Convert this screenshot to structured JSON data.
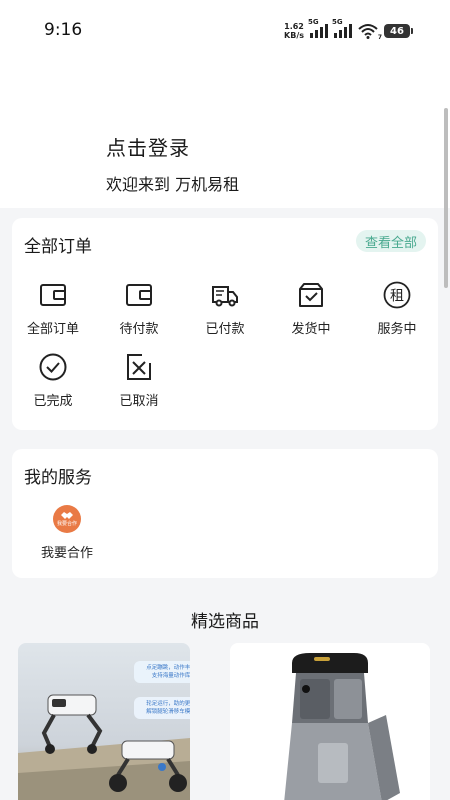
{
  "status_bar": {
    "time": "9:16",
    "net_speed_value": "1.62",
    "net_speed_unit": "KB/s",
    "signal1_tag": "5G",
    "signal2_tag": "5G",
    "wifi_tag": "7",
    "battery": "46"
  },
  "header": {
    "login_text": "点击登录",
    "welcome_text": "欢迎来到 万机易租"
  },
  "orders": {
    "title": "全部订单",
    "view_all": "查看全部",
    "items": [
      {
        "label": "全部订单",
        "icon": "wallet-icon"
      },
      {
        "label": "待付款",
        "icon": "wallet-icon"
      },
      {
        "label": "已付款",
        "icon": "truck-icon"
      },
      {
        "label": "发货中",
        "icon": "package-icon"
      },
      {
        "label": "服务中",
        "icon": "rent-badge-icon",
        "glyph": "租"
      },
      {
        "label": "已完成",
        "icon": "check-circle-icon"
      },
      {
        "label": "已取消",
        "icon": "cancel-doc-icon"
      }
    ]
  },
  "services": {
    "title": "我的服务",
    "items": [
      {
        "label": "我要合作",
        "icon": "handshake-icon",
        "icon_text": "我要合作"
      }
    ]
  },
  "featured": {
    "title": "精选商品",
    "products": [
      {
        "image": "robot-dog-photo",
        "badges": [
          "点足蹦跳，动作丰富",
          "支持海量动作库",
          "轮足运行，助的更快",
          "解锁腿轮滑移车模式"
        ]
      },
      {
        "image": "delivery-robot-photo"
      }
    ]
  },
  "colors": {
    "accent": "#49a98f",
    "accent_bg": "#e4f4f0",
    "coop_orange": "#e97a45",
    "page_bg": "#f4f5f7"
  }
}
